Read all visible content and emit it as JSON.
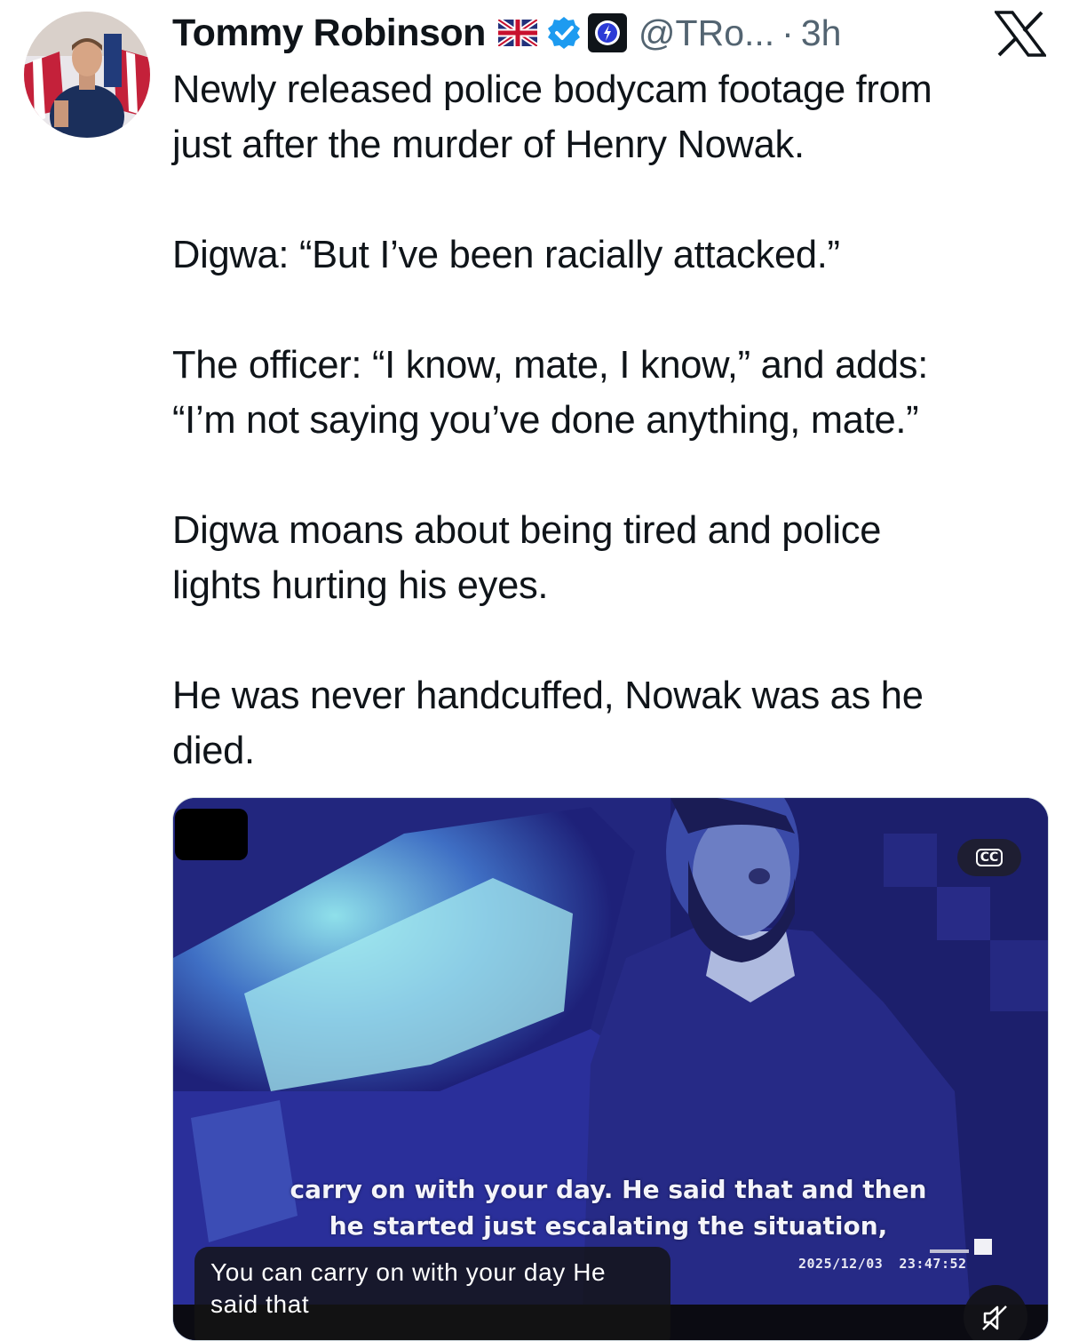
{
  "author": {
    "name": "Tommy Robinson",
    "flag_emoji": "united-kingdom-flag-icon",
    "verified_badge": "verified-badge-icon",
    "affiliate_badge": "affiliate-badge-icon",
    "handle": "@TRo...",
    "separator": "·",
    "time": "3h"
  },
  "platform_logo": "x-logo-icon",
  "tweet": {
    "paragraphs": [
      {
        "lines": [
          "Newly released police bodycam footage from",
          "just after the murder of Henry Nowak."
        ]
      },
      {
        "lines": [
          "Digwa: “But I’ve been racially attacked.”"
        ]
      },
      {
        "lines": [
          "The officer: “I know, mate, I know,” and adds:",
          "“I’m not saying you’ve done anything, mate.”"
        ]
      },
      {
        "lines": [
          "Digwa moans about being tired and police",
          "lights hurting his eyes."
        ]
      },
      {
        "lines": [
          "He was never handcuffed, Nowak was as he",
          "died."
        ]
      }
    ]
  },
  "media": {
    "cc_label": "CC",
    "burned_caption": [
      "carry on with your day. He said that and then",
      "he started just escalating the situation,"
    ],
    "timestamp_date": "2025/12/03",
    "timestamp_time": "23:47:52",
    "live_caption": [
      "You can carry on with your day He",
      "said that"
    ],
    "mute_icon": "speaker-muted-icon"
  },
  "colors": {
    "text": "#0f1419",
    "secondary": "#536471",
    "verified": "#1d9bf0",
    "video_tint": "#2b2f9c"
  }
}
